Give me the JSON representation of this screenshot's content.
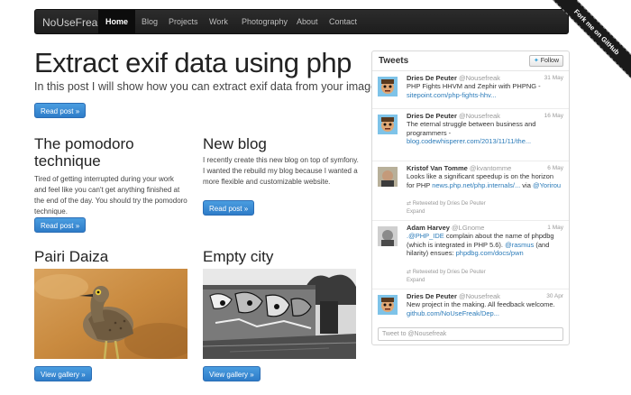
{
  "navbar": {
    "brand": "NoUseFreak",
    "items": [
      {
        "label": "Home",
        "active": true
      },
      {
        "label": "Blog"
      },
      {
        "label": "Projects"
      },
      {
        "label": "Work"
      },
      {
        "label": "Photography"
      },
      {
        "label": "About"
      },
      {
        "label": "Contact"
      }
    ]
  },
  "ribbon": {
    "label": "Fork me on GitHub"
  },
  "hero": {
    "title": "Extract exif data using php",
    "subtitle": "In this post I will show how you can extract exif data from your images.",
    "button": "Read post »"
  },
  "posts": [
    {
      "title": "The pomodoro technique",
      "text": "Tired of getting interrupted during your work and feel like you can't get anything finished at the end of the day. You should try the pomodoro technique.",
      "button": "Read post »"
    },
    {
      "title": "New blog",
      "text": "I recently create this new blog on top of symfony. I wanted the rebuild my blog because I wanted a more flexible and customizable website.",
      "button": "Read post »"
    }
  ],
  "galleries": [
    {
      "title": "Pairi Daiza",
      "button": "View gallery »"
    },
    {
      "title": "Empty city",
      "button": "View gallery »"
    }
  ],
  "tweets": {
    "title": "Tweets",
    "follow": "Follow",
    "compose_placeholder": "Tweet to @Nousefreak",
    "items": [
      {
        "name": "Dries De Peuter",
        "handle": "@Nousefreak",
        "date": "31 May",
        "text": "PHP Fights HHVM and Zephir with PHPNG -",
        "link": "sitepoint.com/php-fights-hhv..."
      },
      {
        "name": "Dries De Peuter",
        "handle": "@Nousefreak",
        "date": "16 May",
        "text": "The eternal struggle between business and programmers -",
        "link": "blog.codewhisperer.com/2013/11/11/the..."
      },
      {
        "name": "Kristof Van Tomme",
        "handle": "@kvantomme",
        "date": "6 May",
        "text": "Looks like a significant speedup is on the horizon for PHP",
        "link": "news.php.net/php.internals/...",
        "text2": "via",
        "link2": "@Yorirou",
        "retweet": "Retweeted by Dries De Peuter",
        "expand": "Expand"
      },
      {
        "name": "Adam Harvey",
        "handle": "@LGnome",
        "date": "1 May",
        "link_pre": ".@PHP_IDE",
        "text": "complain about the name of phpdbg (which is integrated in PHP 5.6).",
        "link": "@rasmus",
        "text2": "(and hilarity) ensues:",
        "link2": "phpdbg.com/docs/pwn",
        "retweet": "Retweeted by Dries De Peuter",
        "expand": "Expand"
      },
      {
        "name": "Dries De Peuter",
        "handle": "@Nousefreak",
        "date": "30 Apr",
        "text": "New project in the making. All feedback welcome.",
        "link": "github.com/NoUseFreak/Dep..."
      }
    ]
  },
  "colors": {
    "accent": "#2e7cc8",
    "navbar": "#222222",
    "link": "#2b7bb9"
  }
}
